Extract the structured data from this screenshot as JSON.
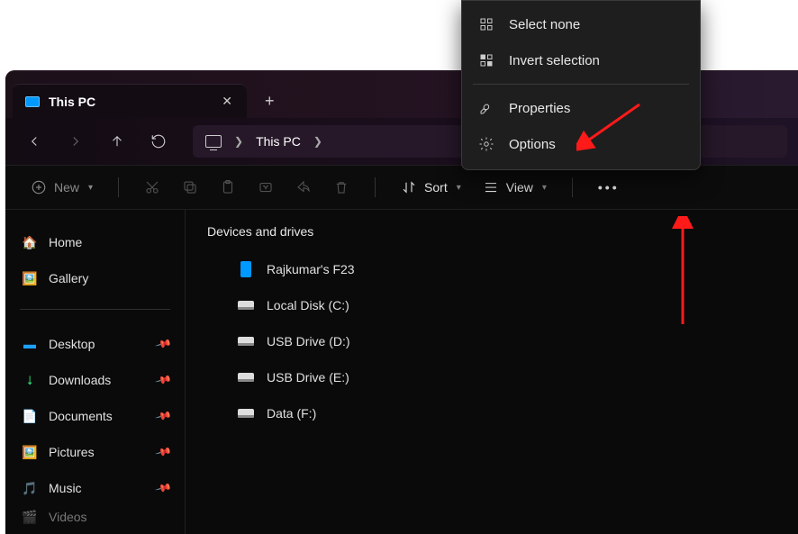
{
  "tab": {
    "title": "This PC"
  },
  "breadcrumb": {
    "location": "This PC"
  },
  "toolbar": {
    "new_label": "New",
    "sort_label": "Sort",
    "view_label": "View"
  },
  "sidebar": {
    "quick": [
      {
        "label": "Home"
      },
      {
        "label": "Gallery"
      }
    ],
    "pinned": [
      {
        "label": "Desktop"
      },
      {
        "label": "Downloads"
      },
      {
        "label": "Documents"
      },
      {
        "label": "Pictures"
      },
      {
        "label": "Music"
      },
      {
        "label": "Videos"
      }
    ]
  },
  "main": {
    "group_header": "Devices and drives",
    "drives": [
      {
        "label": "Rajkumar's F23"
      },
      {
        "label": "Local Disk (C:)"
      },
      {
        "label": "USB Drive (D:)"
      },
      {
        "label": "USB Drive (E:)"
      },
      {
        "label": "Data (F:)"
      }
    ]
  },
  "ctx": {
    "items": [
      {
        "label": "Select none"
      },
      {
        "label": "Invert selection"
      },
      {
        "label": "Properties"
      },
      {
        "label": "Options"
      }
    ]
  }
}
